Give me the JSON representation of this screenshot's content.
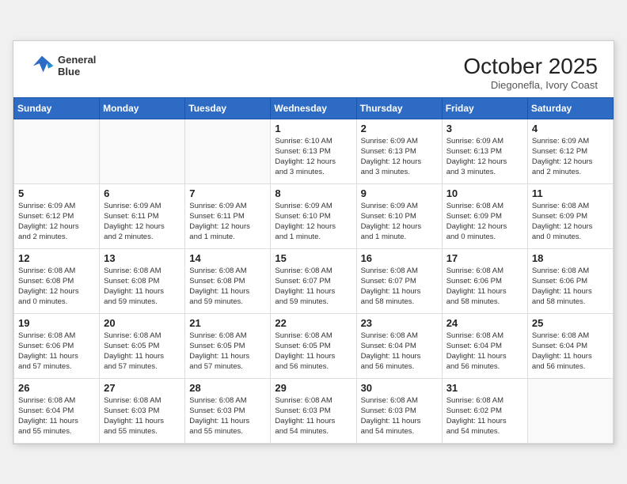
{
  "header": {
    "logo_line1": "General",
    "logo_line2": "Blue",
    "month": "October 2025",
    "location": "Diegonefla, Ivory Coast"
  },
  "weekdays": [
    "Sunday",
    "Monday",
    "Tuesday",
    "Wednesday",
    "Thursday",
    "Friday",
    "Saturday"
  ],
  "weeks": [
    [
      {
        "day": "",
        "info": ""
      },
      {
        "day": "",
        "info": ""
      },
      {
        "day": "",
        "info": ""
      },
      {
        "day": "1",
        "info": "Sunrise: 6:10 AM\nSunset: 6:13 PM\nDaylight: 12 hours\nand 3 minutes."
      },
      {
        "day": "2",
        "info": "Sunrise: 6:09 AM\nSunset: 6:13 PM\nDaylight: 12 hours\nand 3 minutes."
      },
      {
        "day": "3",
        "info": "Sunrise: 6:09 AM\nSunset: 6:13 PM\nDaylight: 12 hours\nand 3 minutes."
      },
      {
        "day": "4",
        "info": "Sunrise: 6:09 AM\nSunset: 6:12 PM\nDaylight: 12 hours\nand 2 minutes."
      }
    ],
    [
      {
        "day": "5",
        "info": "Sunrise: 6:09 AM\nSunset: 6:12 PM\nDaylight: 12 hours\nand 2 minutes."
      },
      {
        "day": "6",
        "info": "Sunrise: 6:09 AM\nSunset: 6:11 PM\nDaylight: 12 hours\nand 2 minutes."
      },
      {
        "day": "7",
        "info": "Sunrise: 6:09 AM\nSunset: 6:11 PM\nDaylight: 12 hours\nand 1 minute."
      },
      {
        "day": "8",
        "info": "Sunrise: 6:09 AM\nSunset: 6:10 PM\nDaylight: 12 hours\nand 1 minute."
      },
      {
        "day": "9",
        "info": "Sunrise: 6:09 AM\nSunset: 6:10 PM\nDaylight: 12 hours\nand 1 minute."
      },
      {
        "day": "10",
        "info": "Sunrise: 6:08 AM\nSunset: 6:09 PM\nDaylight: 12 hours\nand 0 minutes."
      },
      {
        "day": "11",
        "info": "Sunrise: 6:08 AM\nSunset: 6:09 PM\nDaylight: 12 hours\nand 0 minutes."
      }
    ],
    [
      {
        "day": "12",
        "info": "Sunrise: 6:08 AM\nSunset: 6:08 PM\nDaylight: 12 hours\nand 0 minutes."
      },
      {
        "day": "13",
        "info": "Sunrise: 6:08 AM\nSunset: 6:08 PM\nDaylight: 11 hours\nand 59 minutes."
      },
      {
        "day": "14",
        "info": "Sunrise: 6:08 AM\nSunset: 6:08 PM\nDaylight: 11 hours\nand 59 minutes."
      },
      {
        "day": "15",
        "info": "Sunrise: 6:08 AM\nSunset: 6:07 PM\nDaylight: 11 hours\nand 59 minutes."
      },
      {
        "day": "16",
        "info": "Sunrise: 6:08 AM\nSunset: 6:07 PM\nDaylight: 11 hours\nand 58 minutes."
      },
      {
        "day": "17",
        "info": "Sunrise: 6:08 AM\nSunset: 6:06 PM\nDaylight: 11 hours\nand 58 minutes."
      },
      {
        "day": "18",
        "info": "Sunrise: 6:08 AM\nSunset: 6:06 PM\nDaylight: 11 hours\nand 58 minutes."
      }
    ],
    [
      {
        "day": "19",
        "info": "Sunrise: 6:08 AM\nSunset: 6:06 PM\nDaylight: 11 hours\nand 57 minutes."
      },
      {
        "day": "20",
        "info": "Sunrise: 6:08 AM\nSunset: 6:05 PM\nDaylight: 11 hours\nand 57 minutes."
      },
      {
        "day": "21",
        "info": "Sunrise: 6:08 AM\nSunset: 6:05 PM\nDaylight: 11 hours\nand 57 minutes."
      },
      {
        "day": "22",
        "info": "Sunrise: 6:08 AM\nSunset: 6:05 PM\nDaylight: 11 hours\nand 56 minutes."
      },
      {
        "day": "23",
        "info": "Sunrise: 6:08 AM\nSunset: 6:04 PM\nDaylight: 11 hours\nand 56 minutes."
      },
      {
        "day": "24",
        "info": "Sunrise: 6:08 AM\nSunset: 6:04 PM\nDaylight: 11 hours\nand 56 minutes."
      },
      {
        "day": "25",
        "info": "Sunrise: 6:08 AM\nSunset: 6:04 PM\nDaylight: 11 hours\nand 56 minutes."
      }
    ],
    [
      {
        "day": "26",
        "info": "Sunrise: 6:08 AM\nSunset: 6:04 PM\nDaylight: 11 hours\nand 55 minutes."
      },
      {
        "day": "27",
        "info": "Sunrise: 6:08 AM\nSunset: 6:03 PM\nDaylight: 11 hours\nand 55 minutes."
      },
      {
        "day": "28",
        "info": "Sunrise: 6:08 AM\nSunset: 6:03 PM\nDaylight: 11 hours\nand 55 minutes."
      },
      {
        "day": "29",
        "info": "Sunrise: 6:08 AM\nSunset: 6:03 PM\nDaylight: 11 hours\nand 54 minutes."
      },
      {
        "day": "30",
        "info": "Sunrise: 6:08 AM\nSunset: 6:03 PM\nDaylight: 11 hours\nand 54 minutes."
      },
      {
        "day": "31",
        "info": "Sunrise: 6:08 AM\nSunset: 6:02 PM\nDaylight: 11 hours\nand 54 minutes."
      },
      {
        "day": "",
        "info": ""
      }
    ]
  ]
}
